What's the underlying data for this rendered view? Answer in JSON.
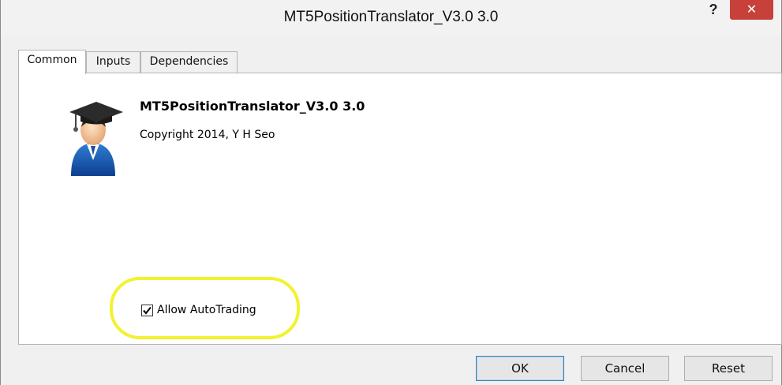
{
  "window": {
    "title": "MT5PositionTranslator_V3.0 3.0",
    "help_label": "?",
    "close_label": "✕"
  },
  "tabs": [
    {
      "label": "Common",
      "active": true
    },
    {
      "label": "Inputs",
      "active": false
    },
    {
      "label": "Dependencies",
      "active": false
    }
  ],
  "common": {
    "app_name": "MT5PositionTranslator_V3.0 3.0",
    "copyright": "Copyright 2014, Y H Seo",
    "icon": "graduate-user-icon",
    "allow_autotrading": {
      "label": "Allow AutoTrading",
      "checked": true
    }
  },
  "buttons": {
    "ok": "OK",
    "cancel": "Cancel",
    "reset": "Reset"
  },
  "colors": {
    "highlight": "#f2f230",
    "close_button": "#c7413a"
  }
}
